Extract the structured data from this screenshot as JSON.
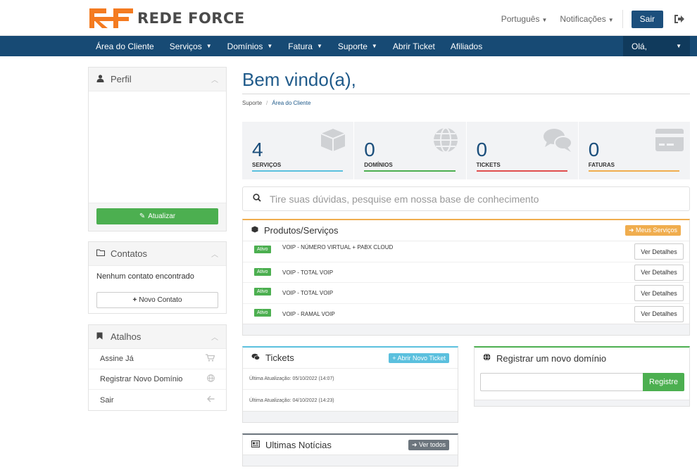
{
  "brand": {
    "name": "REDE FORCE",
    "accent": "#f47b20"
  },
  "topbar": {
    "language": "Português",
    "notifications": "Notificações",
    "logout_label": "Sair"
  },
  "nav": {
    "items": [
      {
        "label": "Área do Cliente",
        "caret": false
      },
      {
        "label": "Serviços",
        "caret": true
      },
      {
        "label": "Domínios",
        "caret": true
      },
      {
        "label": "Fatura",
        "caret": true
      },
      {
        "label": "Suporte",
        "caret": true
      },
      {
        "label": "Abrir Ticket",
        "caret": false
      },
      {
        "label": "Afiliados",
        "caret": false
      }
    ],
    "user_menu": "Olá,"
  },
  "sidebar": {
    "perfil": {
      "title": "Perfil",
      "button": "Atualizar"
    },
    "contatos": {
      "title": "Contatos",
      "empty_text": "Nenhum contato encontrado",
      "button": "Novo Contato"
    },
    "atalhos": {
      "title": "Atalhos",
      "items": [
        {
          "label": "Assine Já",
          "icon": "cart-icon"
        },
        {
          "label": "Registrar Novo Domínio",
          "icon": "globe-icon"
        },
        {
          "label": "Sair",
          "icon": "arrow-left-icon"
        }
      ]
    }
  },
  "main": {
    "title": "Bem vindo(a),",
    "breadcrumb": [
      "Suporte",
      "Área do Cliente"
    ],
    "stats": [
      {
        "value": "4",
        "label": "SERVIÇOS",
        "color": "#5bc0de",
        "icon": "cube-icon"
      },
      {
        "value": "0",
        "label": "DOMÍNIOS",
        "color": "#4caf50",
        "icon": "globe-icon"
      },
      {
        "value": "0",
        "label": "TICKETS",
        "color": "#e04e4e",
        "icon": "comments-icon"
      },
      {
        "value": "0",
        "label": "FATURAS",
        "color": "#f0ad4e",
        "icon": "credit-card-icon"
      }
    ],
    "search_placeholder": "Tire suas dúvidas, pesquise em nossa base de conhecimento",
    "products": {
      "title": "Produtos/Serviços",
      "tag": "Meus Serviços",
      "tag_color": "#f0ad4e",
      "status": "Ativo",
      "action": "Ver Detalhes",
      "rows": [
        {
          "name": "VOIP - NÚMERO VIRTUAL + PABX CLOUD"
        },
        {
          "name": "VOIP - TOTAL VOIP"
        },
        {
          "name": "VOIP - TOTAL VOIP"
        },
        {
          "name": "VOIP - RAMAL VOIP"
        }
      ]
    },
    "tickets": {
      "title": "Tickets",
      "tag": "Abrir Novo Ticket",
      "tag_color": "#5bc0de",
      "rows": [
        {
          "text": "Última Atualização: 05/10/2022 (14:07)"
        },
        {
          "text": "Última Atualização: 04/10/2022 (14:23)"
        }
      ]
    },
    "domain": {
      "title": "Registrar um novo domínio",
      "button": "Registre"
    },
    "news": {
      "title": "Ultimas Notícias",
      "tag": "Ver todos",
      "tag_color": "#6c757d"
    }
  }
}
